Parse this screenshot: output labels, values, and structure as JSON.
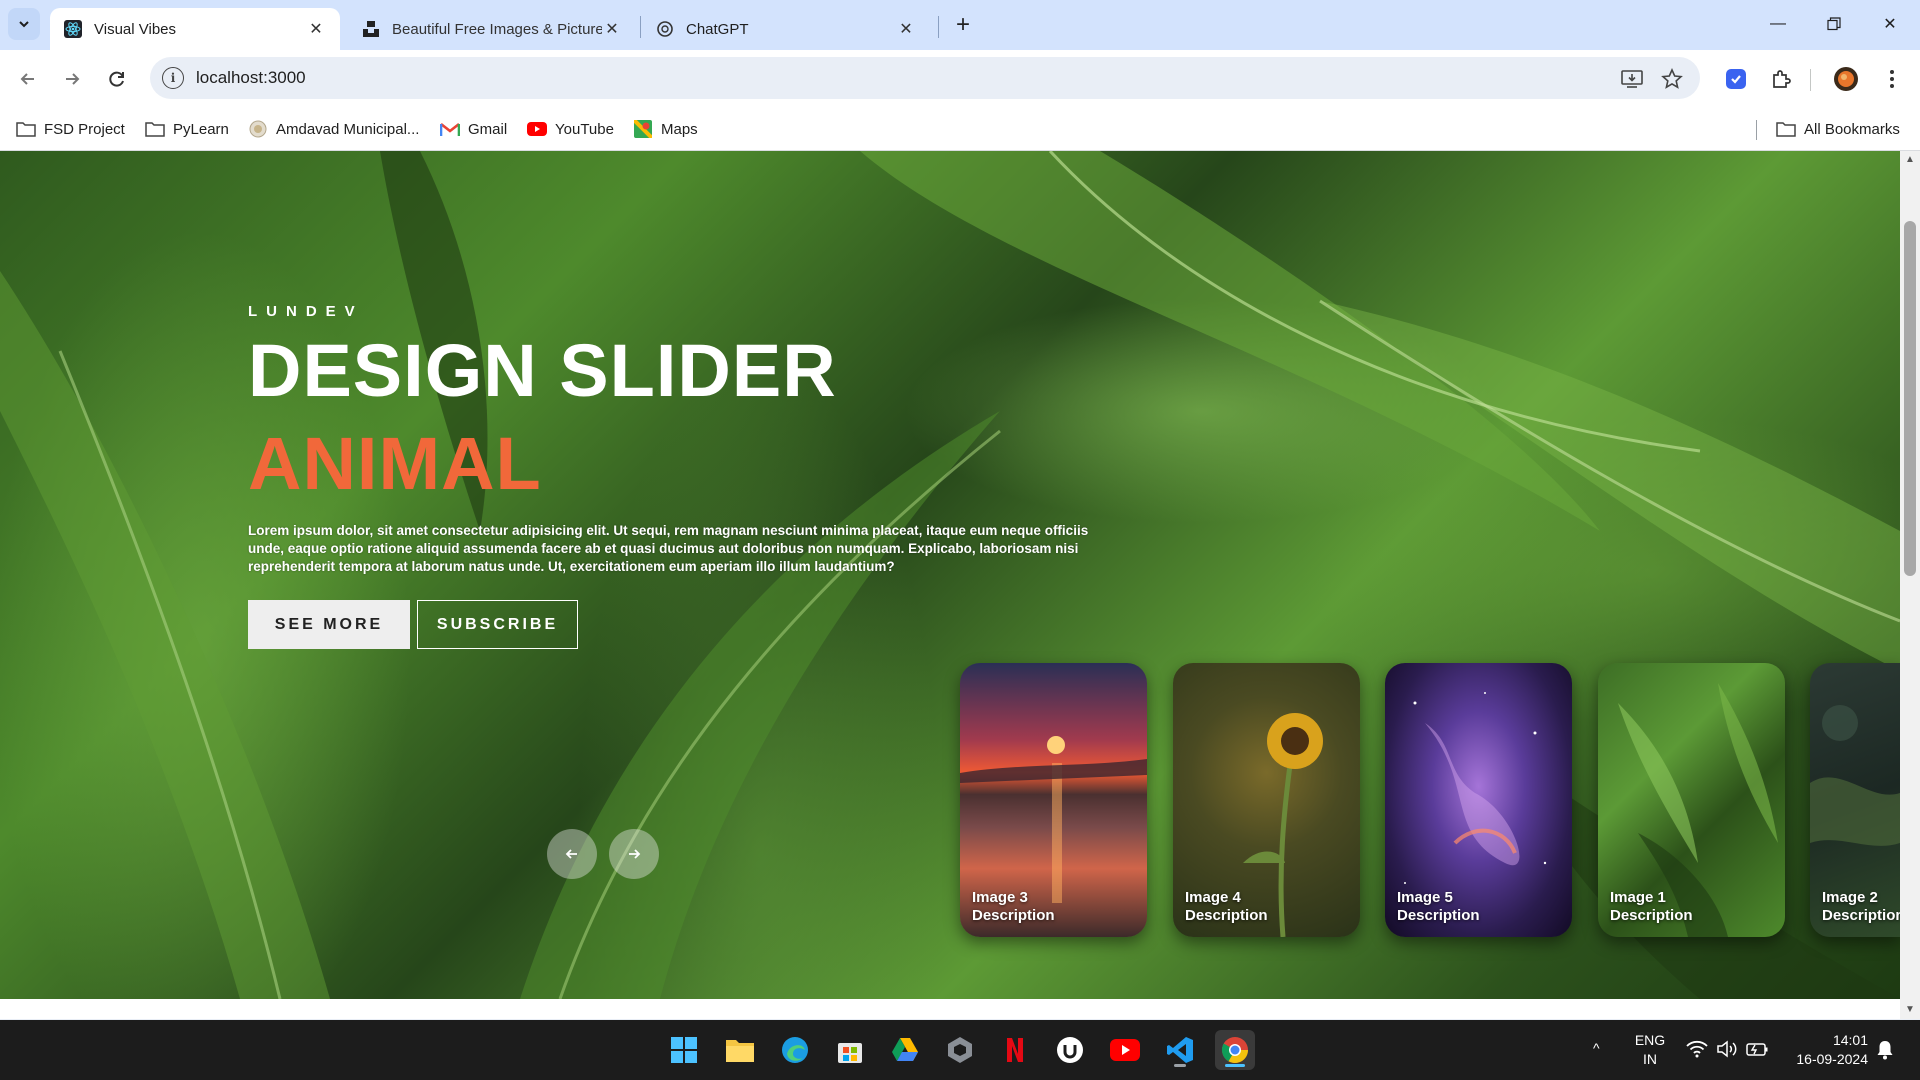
{
  "browser": {
    "tabs": [
      {
        "title": "Visual Vibes",
        "icon": "react-icon",
        "active": true
      },
      {
        "title": "Beautiful Free Images & Pictures",
        "icon": "unsplash-icon",
        "active": false
      },
      {
        "title": "ChatGPT",
        "icon": "chatgpt-icon",
        "active": false
      }
    ],
    "url": "localhost:3000",
    "bookmarks": [
      {
        "label": "FSD Project",
        "icon": "folder-icon"
      },
      {
        "label": "PyLearn",
        "icon": "folder-icon"
      },
      {
        "label": "Amdavad Municipal...",
        "icon": "amc-icon"
      },
      {
        "label": "Gmail",
        "icon": "gmail-icon"
      },
      {
        "label": "YouTube",
        "icon": "youtube-icon"
      },
      {
        "label": "Maps",
        "icon": "maps-icon"
      }
    ],
    "all_bookmarks": "All Bookmarks"
  },
  "hero": {
    "eyebrow": "LUNDEV",
    "title": "DESIGN SLIDER",
    "topic": "ANIMAL",
    "description": "Lorem ipsum dolor, sit amet consectetur adipisicing elit. Ut sequi, rem magnam nesciunt minima placeat, itaque eum neque officiis unde, eaque optio ratione aliquid assumenda facere ab et quasi ducimus aut doloribus non numquam. Explicabo, laboriosam nisi reprehenderit tempora at laborum natus unde. Ut, exercitationem eum aperiam illo illum laudantium?",
    "see_more": "SEE MORE",
    "subscribe": "SUBSCRIBE",
    "accent_color": "#f1683a"
  },
  "thumbnails": [
    {
      "title": "Image 3",
      "subtitle": "Description",
      "theme": "sunset-beach"
    },
    {
      "title": "Image 4",
      "subtitle": "Description",
      "theme": "sunflower"
    },
    {
      "title": "Image 5",
      "subtitle": "Description",
      "theme": "nebula"
    },
    {
      "title": "Image 1",
      "subtitle": "Description",
      "theme": "green-leaves"
    },
    {
      "title": "Image 2",
      "subtitle": "Description",
      "theme": "forest-moss"
    }
  ],
  "taskbar": {
    "apps": [
      "windows-start-icon",
      "file-explorer-icon",
      "edge-icon",
      "microsoft-store-icon",
      "google-drive-icon",
      "unity-icon",
      "netflix-icon",
      "udemy-icon",
      "youtube-icon",
      "vscode-icon",
      "chrome-icon"
    ],
    "language": "ENG",
    "region": "IN",
    "time": "14:01",
    "date": "16-09-2024"
  }
}
